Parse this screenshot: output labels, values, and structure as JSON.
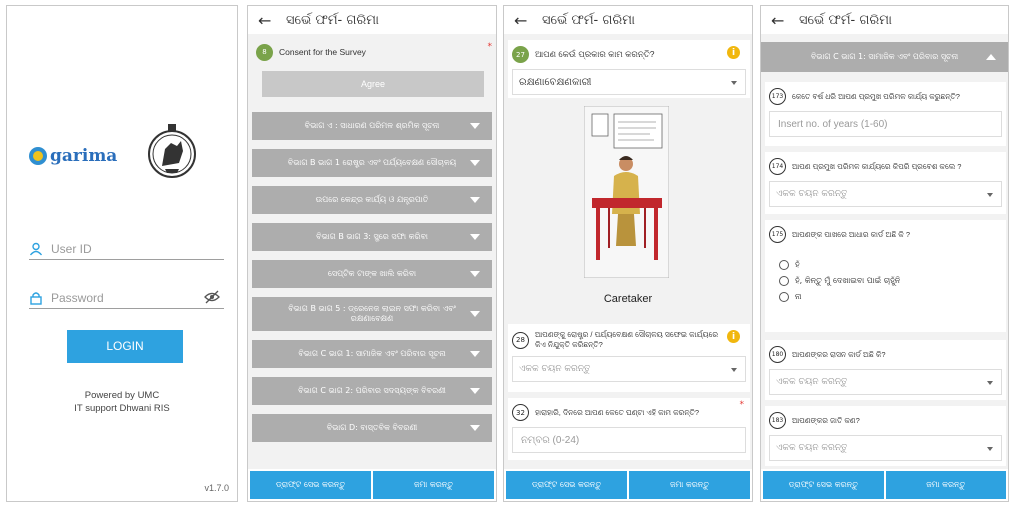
{
  "login": {
    "logo_text": "garima",
    "user_id_placeholder": "User ID",
    "password_placeholder": "Password",
    "login_label": "LOGIN",
    "powered_by": "Powered by UMC",
    "it_support": "IT support Dhwani RIS",
    "version": "v1.7.0"
  },
  "header": {
    "title": "ସର୍ଭେ ଫର୍ମ- ଗରିମା"
  },
  "screen2": {
    "consent_number": "8",
    "consent_label": "Consent for the Survey",
    "agree_label": "Agree",
    "sections": [
      "ବିଭାଗ ଏ : ସାଧାରଣ ପରିମଳ ଶ୍ରମିକ ସୂଚନା",
      "ବିଭାଗ B ଭାଗ 1 ରୋଷ୍ଟ୍ର ଏବଂ ପର୍ଯ୍ୟବେକ୍ଷଣ ସୌଚାଳୟ",
      "ଉପରେ କେନ୍ଦ୍ର କାର୍ଯ୍ୟ ଓ ଯନ୍ତ୍ରପାତି",
      "ବିଭାଗ B ଭାଗ 3: ସ୍ପ୍ରେ ସଫା କରିବା",
      "ସେପ୍ଟିକ ଟାଙ୍କ ଖାଲି କରିବା",
      "ବିଭାଗ B ଭାଗ 5 : ଡ୍ରେନେଜ ଲାଇନ ସଫା କରିବା ଏବଂ ରକ୍ଷଣାବେକ୍ଷଣ",
      "ବିଭାଗ C ଭାଗ 1: ସାମାଜିକ ଏବଂ ପରିବାର ସୂଚନା",
      "ବିଭାଗ C ଭାଗ 2: ପରିବାର ସଦସ୍ୟଙ୍କ ବିବରଣୀ",
      "ବିଭାଗ D: ବାସ୍ତବିକ ବିବରଣୀ"
    ]
  },
  "screen3": {
    "q1_number": "27",
    "q1_text": "ଆପଣ କେଉଁ ପ୍ରକାର କାମ କରନ୍ତି?",
    "q1_value": "ରକ୍ଷଣାବେକ୍ଷଣକାରୀ",
    "caption": "Caretaker",
    "q2_number": "28",
    "q2_text": "ଆପଣଙ୍କୁ ରୋଷ୍ଟ୍ର / ପର୍ଯ୍ୟବେକ୍ଷଣ ସୌଚାଳୟ ସଫେଇ କାର୍ଯ୍ୟରେ କିଏ ନିଯୁକ୍ତି କରିଛନ୍ତି?",
    "q2_placeholder": "ଏକକ ଚୟନ କରନ୍ତୁ",
    "q3_number": "32",
    "q3_text": "ହାରାହାରି, ଦିନରେ ଆପଣ କେତେ ଘଣ୍ଟା ଏହି କାମ କରନ୍ତି?",
    "q3_placeholder": "ନମ୍ବର (0-24)"
  },
  "screen4": {
    "section_header": "ବିଭାଗ C ଭାଗ 1: ସାମାଜିକ ଏବଂ ପରିବାର ସୂଚନା",
    "q173_number": "173",
    "q173_text": "କେତେ ବର୍ଷ ଧରି ଆପଣ ପ୍ରମୁଖ ପରିମଳ କାର୍ଯ୍ୟ କରୁଛନ୍ତି?",
    "q173_placeholder": "Insert no. of years (1-60)",
    "q174_number": "174",
    "q174_text": "ଆପଣ ପ୍ରମୁଖ ପରିମଳ କାର୍ଯ୍ୟରେ କିପରି ପ୍ରବେଶ କଲେ ?",
    "q174_placeholder": "ଏକକ ଚୟନ କରନ୍ତୁ",
    "q175_number": "175",
    "q175_text": "ଆପଣଙ୍କ ପାଖରେ ଆଧାର କାର୍ଡ ଅଛି କି ?",
    "q175_options": [
      "ହଁ",
      "ହଁ, କିନ୍ତୁ ମୁଁ ଦେଖାଇବା ପାଇଁ ଚାହୁଁନି",
      "ନା"
    ],
    "q180_number": "180",
    "q180_text": "ଆପଣଙ୍କର ରାସନ କାର୍ଡ ଅଛି କି?",
    "q180_placeholder": "ଏକକ ଚୟନ କରନ୍ତୁ",
    "q183_number": "183",
    "q183_text": "ଆପଣଙ୍କର ଜାତି କଣ?",
    "q183_placeholder": "ଏକକ ଚୟନ କରନ୍ତୁ"
  },
  "footer": {
    "save_draft": "ଡ୍ରାଫ୍ଟ ସେଭ କରନ୍ତୁ",
    "submit": "ଜମା କରନ୍ତୁ"
  }
}
